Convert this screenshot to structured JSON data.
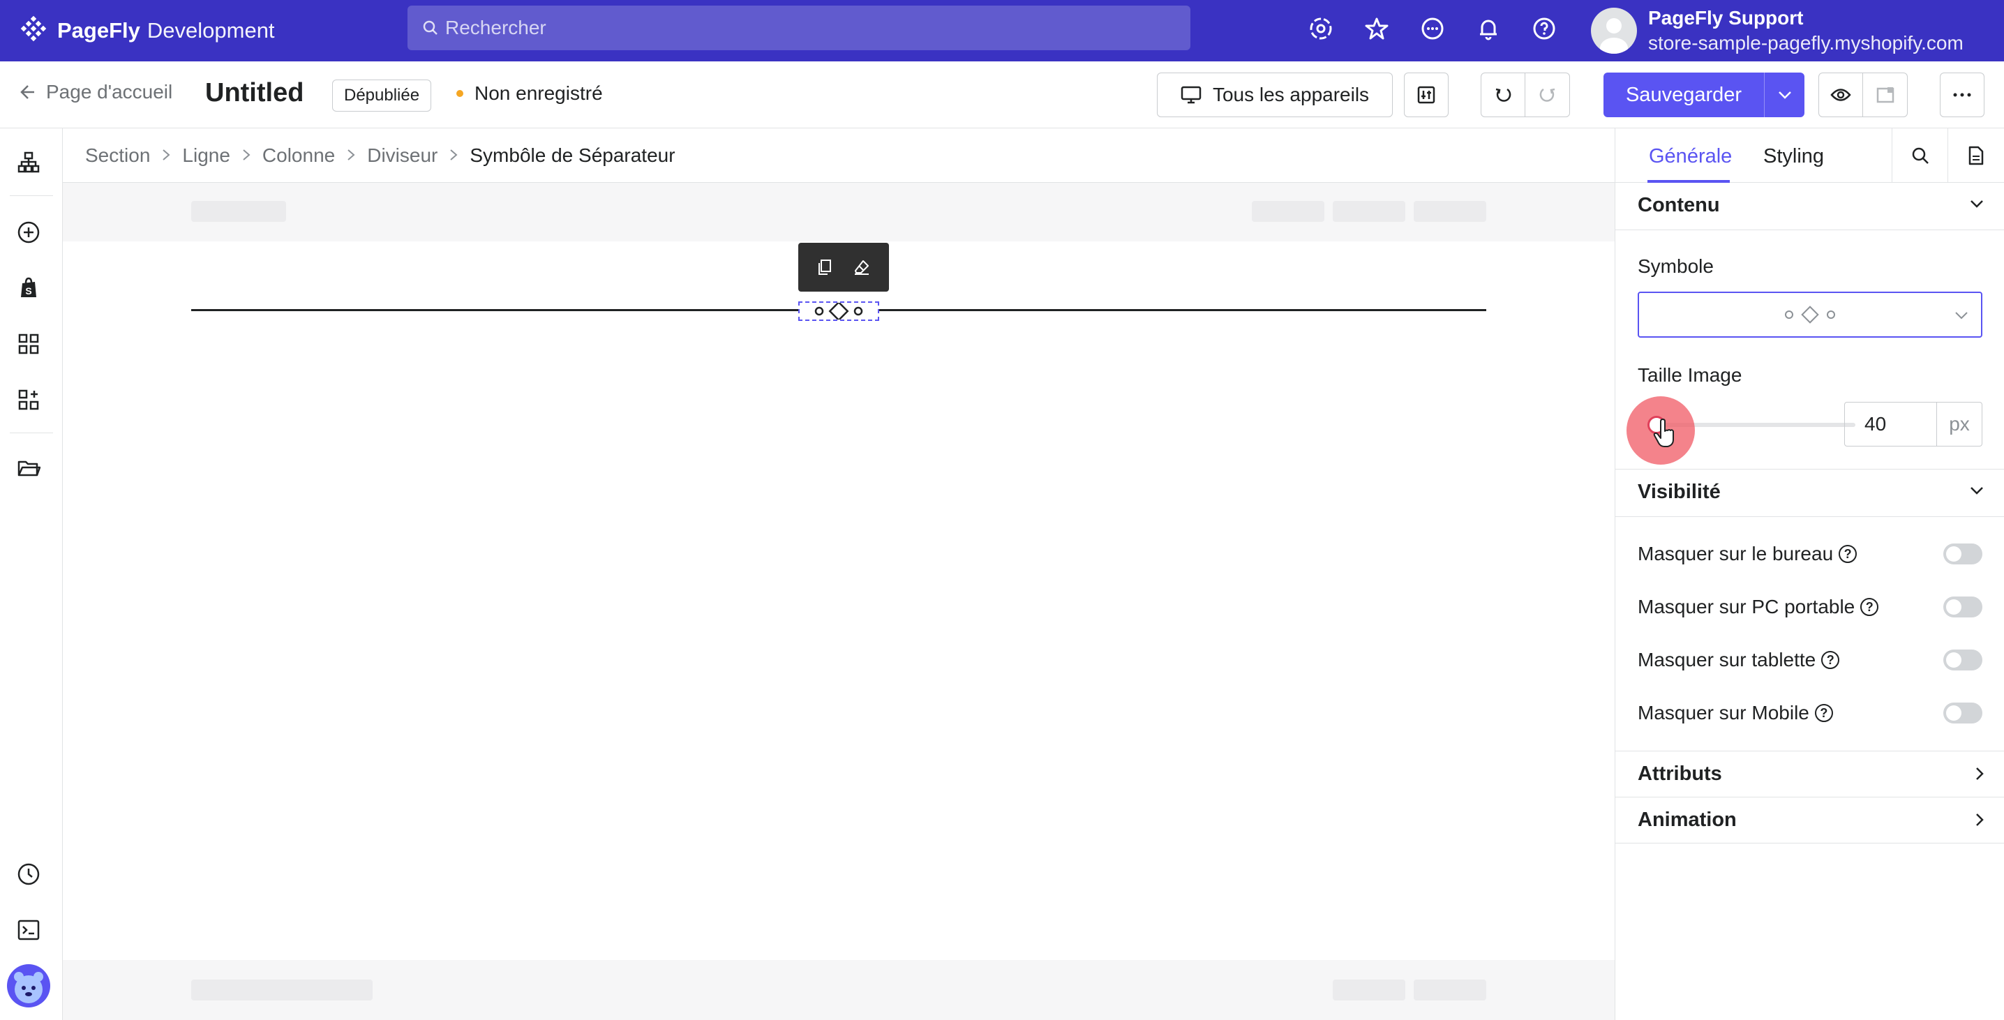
{
  "brand": {
    "name": "PageFly",
    "suffix": "Development"
  },
  "search": {
    "placeholder": "Rechercher"
  },
  "top_icons": [
    "settings-icon",
    "star-icon",
    "chat-icon",
    "bell-icon",
    "help-icon"
  ],
  "user": {
    "name": "PageFly Support",
    "store": "store-sample-pagefly.myshopify.com"
  },
  "header": {
    "back_label": "Page d'accueil",
    "page_title": "Untitled",
    "status_badge": "Dépubliée",
    "unsaved_label": "Non enregistré",
    "device_label": "Tous les appareils",
    "save_label": "Sauvegarder"
  },
  "breadcrumb": [
    "Section",
    "Ligne",
    "Colonne",
    "Diviseur",
    "Symbôle de Séparateur"
  ],
  "panel": {
    "tabs": [
      "Générale",
      "Styling"
    ],
    "content_title": "Contenu",
    "symbol_label": "Symbole",
    "image_size_label": "Taille Image",
    "image_size_value": "40",
    "image_size_unit": "px",
    "visibility_title": "Visibilité",
    "visibility_items": [
      {
        "label": "Masquer sur le bureau",
        "on": false
      },
      {
        "label": "Masquer sur PC portable",
        "on": false
      },
      {
        "label": "Masquer sur tablette",
        "on": false
      },
      {
        "label": "Masquer sur Mobile",
        "on": false
      }
    ],
    "attributes_title": "Attributs",
    "animation_title": "Animation"
  },
  "colors": {
    "topbar": "#3a32c2",
    "accent": "#5a54f2"
  }
}
